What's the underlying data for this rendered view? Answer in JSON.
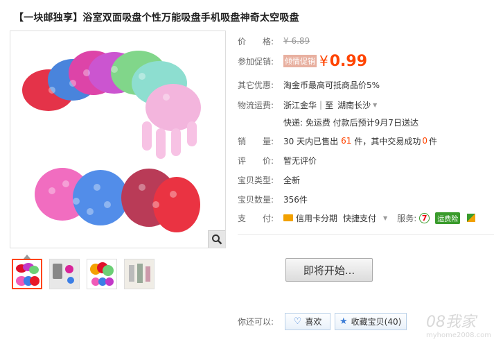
{
  "product": {
    "title": "【一块邮独享】浴室双面吸盘个性万能吸盘手机吸盘神奇太空吸盘"
  },
  "props": {
    "price_label": "价　　格:",
    "price_orig": "¥ 6.89",
    "promo_label": "参加促销:",
    "promo_badge": "倾情促销",
    "promo_yen": "¥",
    "promo_price": "0.99",
    "discount_label": "其它优惠:",
    "discount_value": "淘金币最高可抵商品价5%",
    "shipping_label": "物流运费:",
    "shipping_from": "浙江金华",
    "shipping_sep": "|",
    "shipping_to_word": "至",
    "shipping_to": "湖南长沙",
    "shipping_note": "快递: 免运费 付款后预计9月7日送达",
    "sales_label": "销　　量:",
    "sales_prefix": "30 天内已售出",
    "sales_count": "61",
    "sales_mid": "件，其中交易成功",
    "sales_success": "0",
    "sales_suffix": "件",
    "rating_label": "评　　价:",
    "rating_value": "暂无评价",
    "type_label": "宝贝类型:",
    "type_value": "全新",
    "qty_label": "宝贝数量:",
    "qty_value": "356件",
    "pay_label": "支　　付:",
    "pay_credit": "信用卡分期",
    "pay_quick": "快捷支付",
    "service_label": "服务:",
    "service_badge": "运费险"
  },
  "actions": {
    "buy_label": "即将开始...",
    "more_label": "你还可以:",
    "like_label": "喜欢",
    "fav_label": "收藏宝贝(40)"
  },
  "watermark": {
    "brand": "08我家",
    "url": "myhome2008.com"
  },
  "colors": {
    "accent": "#ff4400",
    "badge_green": "#3a9b2c"
  }
}
